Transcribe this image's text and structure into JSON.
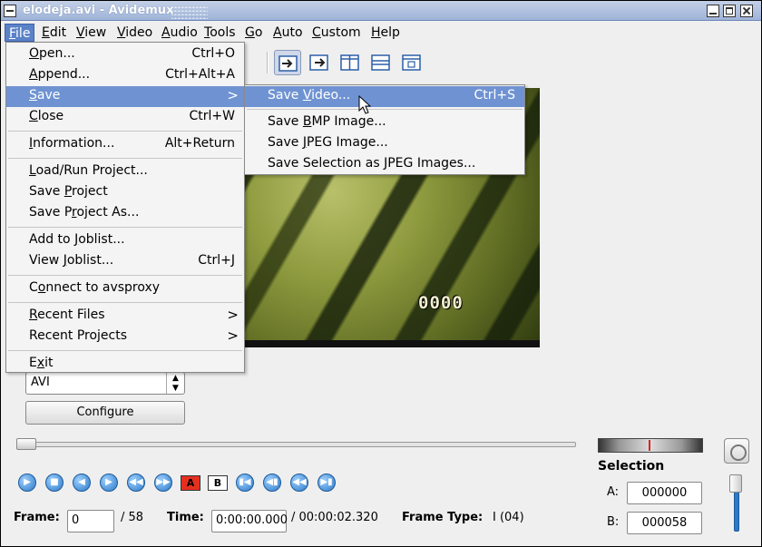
{
  "window": {
    "title": "elodeja.avi - Avidemux"
  },
  "menubar": {
    "items": [
      {
        "label": "File",
        "mnemonic": "F",
        "rest": "ile"
      },
      {
        "label": "Edit",
        "mnemonic": "E",
        "rest": "dit"
      },
      {
        "label": "View",
        "mnemonic": "V",
        "rest": "iew"
      },
      {
        "label": "Video",
        "mnemonic": "V",
        "rest": "ideo"
      },
      {
        "label": "Audio",
        "mnemonic": "A",
        "rest": "udio"
      },
      {
        "label": "Tools",
        "mnemonic": "T",
        "rest": "ools"
      },
      {
        "label": "Go",
        "mnemonic": "G",
        "rest": "o"
      },
      {
        "label": "Auto",
        "mnemonic": "A",
        "rest": "uto"
      },
      {
        "label": "Custom",
        "mnemonic": "C",
        "rest": "ustom"
      },
      {
        "label": "Help",
        "mnemonic": "H",
        "rest": "elp"
      }
    ]
  },
  "file_menu": {
    "open": {
      "pre": "",
      "u": "O",
      "post": "pen...",
      "shortcut": "Ctrl+O"
    },
    "append": {
      "pre": "",
      "u": "A",
      "post": "ppend...",
      "shortcut": "Ctrl+Alt+A"
    },
    "save": {
      "pre": "",
      "u": "S",
      "post": "ave"
    },
    "close": {
      "pre": "",
      "u": "C",
      "post": "lose",
      "shortcut": "Ctrl+W"
    },
    "information": {
      "pre": "",
      "u": "I",
      "post": "nformation...",
      "shortcut": "Alt+Return"
    },
    "load_project": {
      "pre": "",
      "u": "L",
      "post": "oad/Run Project..."
    },
    "save_project": {
      "pre": "Save ",
      "u": "P",
      "post": "roject"
    },
    "save_project_as": {
      "pre": "Save P",
      "u": "r",
      "post": "oject As..."
    },
    "add_joblist": {
      "pre": "Add to ",
      "u": "J",
      "post": "oblist..."
    },
    "view_joblist": {
      "pre": "View ",
      "u": "J",
      "post": "oblist...",
      "shortcut": "Ctrl+J"
    },
    "connect": {
      "pre": "C",
      "u": "o",
      "post": "nnect to avsproxy"
    },
    "recent_files": {
      "pre": "",
      "u": "R",
      "post": "ecent Files"
    },
    "recent_projects": {
      "pre": "Recent Projects",
      "u": "",
      "post": ""
    },
    "exit": {
      "pre": "E",
      "u": "x",
      "post": "it"
    }
  },
  "save_submenu": {
    "save_video": {
      "pre": "Save ",
      "u": "V",
      "post": "ideo...",
      "shortcut": "Ctrl+S"
    },
    "save_bmp": {
      "pre": "Save ",
      "u": "B",
      "post": "MP Image..."
    },
    "save_jpeg": {
      "pre": "Save ",
      "u": "J",
      "post": "PEG Image..."
    },
    "save_selection_jpeg": {
      "pre": "Save Selection as JPEG Images...",
      "u": "",
      "post": ""
    }
  },
  "video_overlay_text": "0000",
  "format": {
    "selected": "AVI",
    "configure_label": "Configure"
  },
  "status": {
    "frame_label": "Frame:",
    "frame_value": "0",
    "frame_total": "/ 58",
    "time_label": "Time:",
    "time_value": "0:00:00.000",
    "time_total": "/ 00:00:02.320",
    "frame_type_label": "Frame Type:",
    "frame_type_value": "I (04)"
  },
  "selection": {
    "title": "Selection",
    "a_label": "A:",
    "a_value": "000000",
    "b_label": "B:",
    "b_value": "000058"
  },
  "markers": {
    "a": "A",
    "b": "B"
  },
  "icons": {
    "play": "play-icon",
    "stop": "stop-icon",
    "prev_frame": "previous-frame-icon",
    "next_frame": "next-frame-icon",
    "prev_keyframe": "previous-keyframe-icon",
    "next_keyframe": "next-keyframe-icon",
    "first_frame": "first-frame-icon",
    "prev_black": "previous-black-frame-icon",
    "next_black": "next-black-frame-icon",
    "last_frame": "last-frame-icon"
  },
  "colors": {
    "menu_highlight": "#6f93d2",
    "title_bar": "#9fb4d9",
    "marker_a": "#e5301f"
  }
}
